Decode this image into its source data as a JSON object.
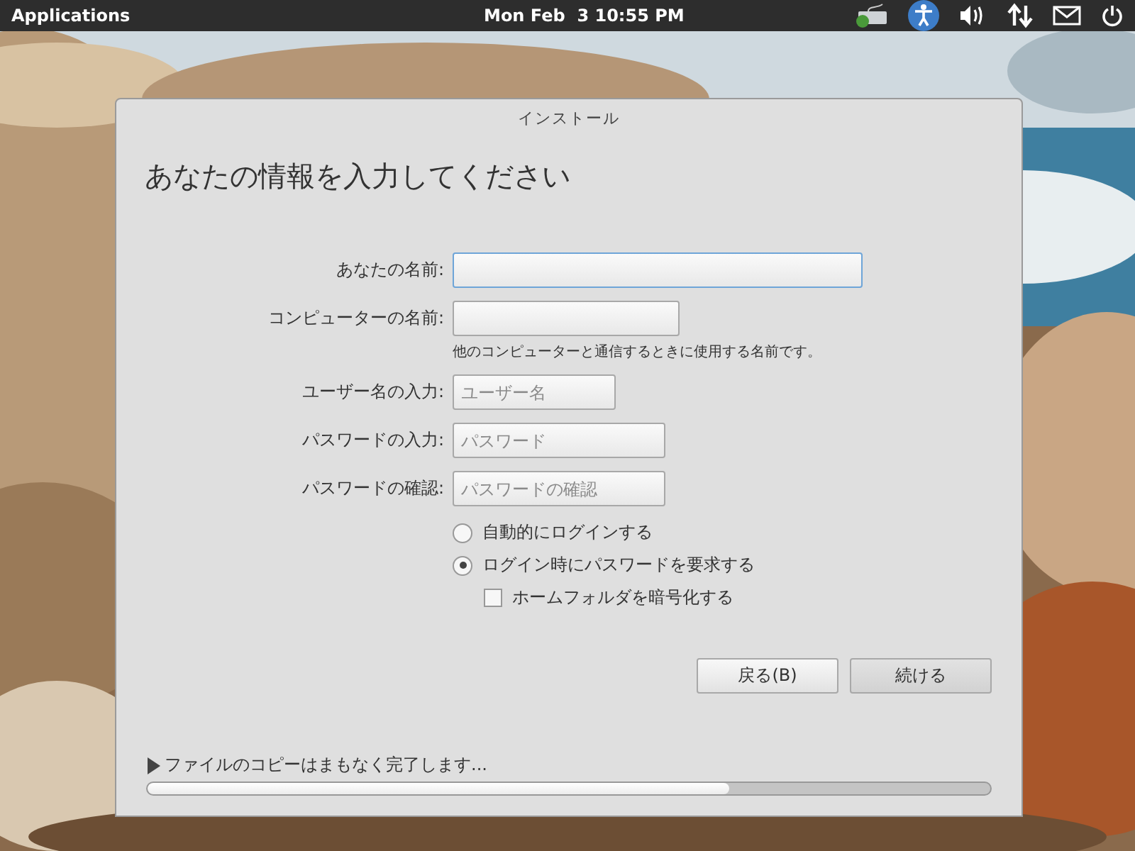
{
  "panel": {
    "menu": "Applications",
    "clock": "Mon Feb  3 10:55 PM"
  },
  "window": {
    "title": "インストール"
  },
  "heading": "あなたの情報を入力してください",
  "fields": [
    {
      "label": "あなたの名前:",
      "focused": true
    },
    {
      "label": "コンピューターの名前:",
      "focused": false,
      "hint": "他のコンピューターと通信するときに使用する名前です。"
    },
    {
      "label": "ユーザー名の入力:",
      "placeholder": "ユーザー名",
      "focused": false
    },
    {
      "label": "パスワードの入力:",
      "placeholder": "パスワード",
      "focused": false
    },
    {
      "label": "パスワードの確認:",
      "placeholder": "パスワードの確認",
      "focused": false
    }
  ],
  "options": [
    {
      "kind": "radio",
      "label": "自動的にログインする",
      "selected": false
    },
    {
      "kind": "radio",
      "label": "ログイン時にパスワードを要求する",
      "selected": true
    },
    {
      "kind": "checkbox",
      "label": "ホームフォルダを暗号化する",
      "checked": false
    }
  ],
  "buttons": [
    "戻る(B)",
    "続ける"
  ],
  "progress": {
    "label": "ファイルのコピーはまもなく完了します...",
    "level": 0.69
  }
}
